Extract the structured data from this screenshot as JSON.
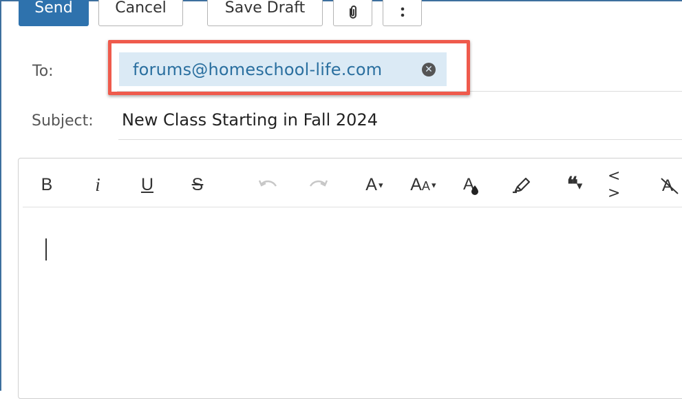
{
  "toolbar": {
    "send_label": "Send",
    "cancel_label": "Cancel",
    "save_draft_label": "Save Draft",
    "attach_icon": "paperclip-icon",
    "more_icon": "more-vertical-icon"
  },
  "to": {
    "label": "To:",
    "recipients": [
      {
        "email": "forums@homeschool-life.com",
        "remove_icon": "remove-circle-icon"
      }
    ]
  },
  "subject": {
    "label": "Subject:",
    "value": "New Class Starting in Fall 2024"
  },
  "editor": {
    "toolbar": [
      {
        "name": "bold",
        "glyph": "B"
      },
      {
        "name": "italic",
        "glyph": "i"
      },
      {
        "name": "underline",
        "glyph": "U"
      },
      {
        "name": "strikethrough",
        "glyph": "S"
      },
      {
        "name": "undo",
        "glyph": "↶",
        "disabled": true
      },
      {
        "name": "redo",
        "glyph": "↷",
        "disabled": true
      },
      {
        "name": "font-size",
        "glyph": "A▾"
      },
      {
        "name": "font-case",
        "glyph": "AA▾"
      },
      {
        "name": "text-color",
        "glyph": "A"
      },
      {
        "name": "highlight",
        "glyph": "✎"
      },
      {
        "name": "blockquote",
        "glyph": "66▾"
      },
      {
        "name": "code",
        "glyph": "<>"
      },
      {
        "name": "clear-formatting",
        "glyph": "A"
      }
    ],
    "body": ""
  },
  "colors": {
    "primary": "#2e72ad",
    "chip_bg": "#dbeaf5",
    "chip_text": "#2a6f9f",
    "highlight_border": "#ef5a4c"
  }
}
